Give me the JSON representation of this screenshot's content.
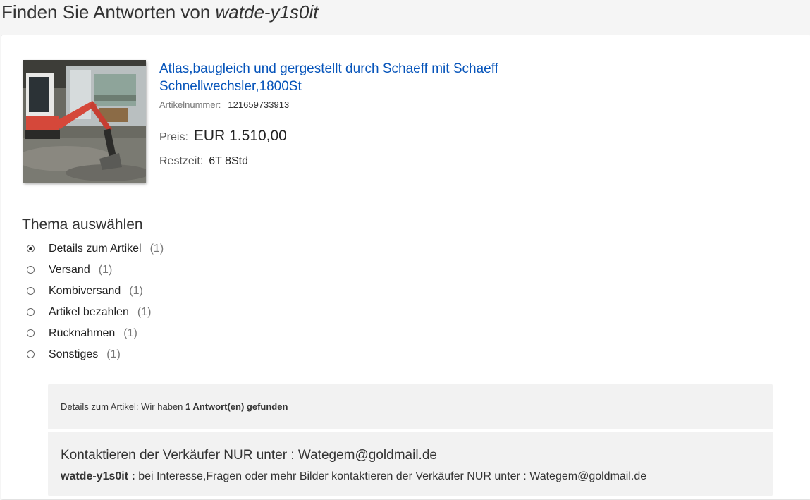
{
  "header": {
    "title_prefix": "Finden Sie Antworten von ",
    "seller_name": "watde-y1s0it"
  },
  "item": {
    "image_icon": "excavator-photo",
    "title": "Atlas,baugleich und gergestellt durch Schaeff mit Schaeff Schnellwechsler,1800St",
    "number_label": "Artikelnummer:",
    "number_value": "121659733913",
    "price_label": "Preis:",
    "price_value": "EUR 1.510,00",
    "time_label": "Restzeit:",
    "time_value": "6T 8Std"
  },
  "topics": {
    "heading": "Thema auswählen",
    "items": [
      {
        "label": "Details zum Artikel",
        "count": "(1)",
        "selected": true
      },
      {
        "label": "Versand",
        "count": "(1)",
        "selected": false
      },
      {
        "label": "Kombiversand",
        "count": "(1)",
        "selected": false
      },
      {
        "label": "Artikel bezahlen",
        "count": "(1)",
        "selected": false
      },
      {
        "label": "Rücknahmen",
        "count": "(1)",
        "selected": false
      },
      {
        "label": "Sonstiges",
        "count": "(1)",
        "selected": false
      }
    ]
  },
  "answers": {
    "summary_prefix": "Details zum Artikel: Wir haben ",
    "summary_bold": "1 Antwort(en) gefunden",
    "question": "Kontaktieren der Verkäufer NUR unter : Wategem@goldmail.de",
    "answer_author": "watde-y1s0it :",
    "answer_text": " bei Interesse,Fragen oder mehr Bilder kontaktieren der Verkäufer NUR unter : Wategem@goldmail.de"
  },
  "colors": {
    "link": "#0654ba",
    "answer_box_bg": "#f2f2f2",
    "page_bg": "#f5f5f5"
  }
}
